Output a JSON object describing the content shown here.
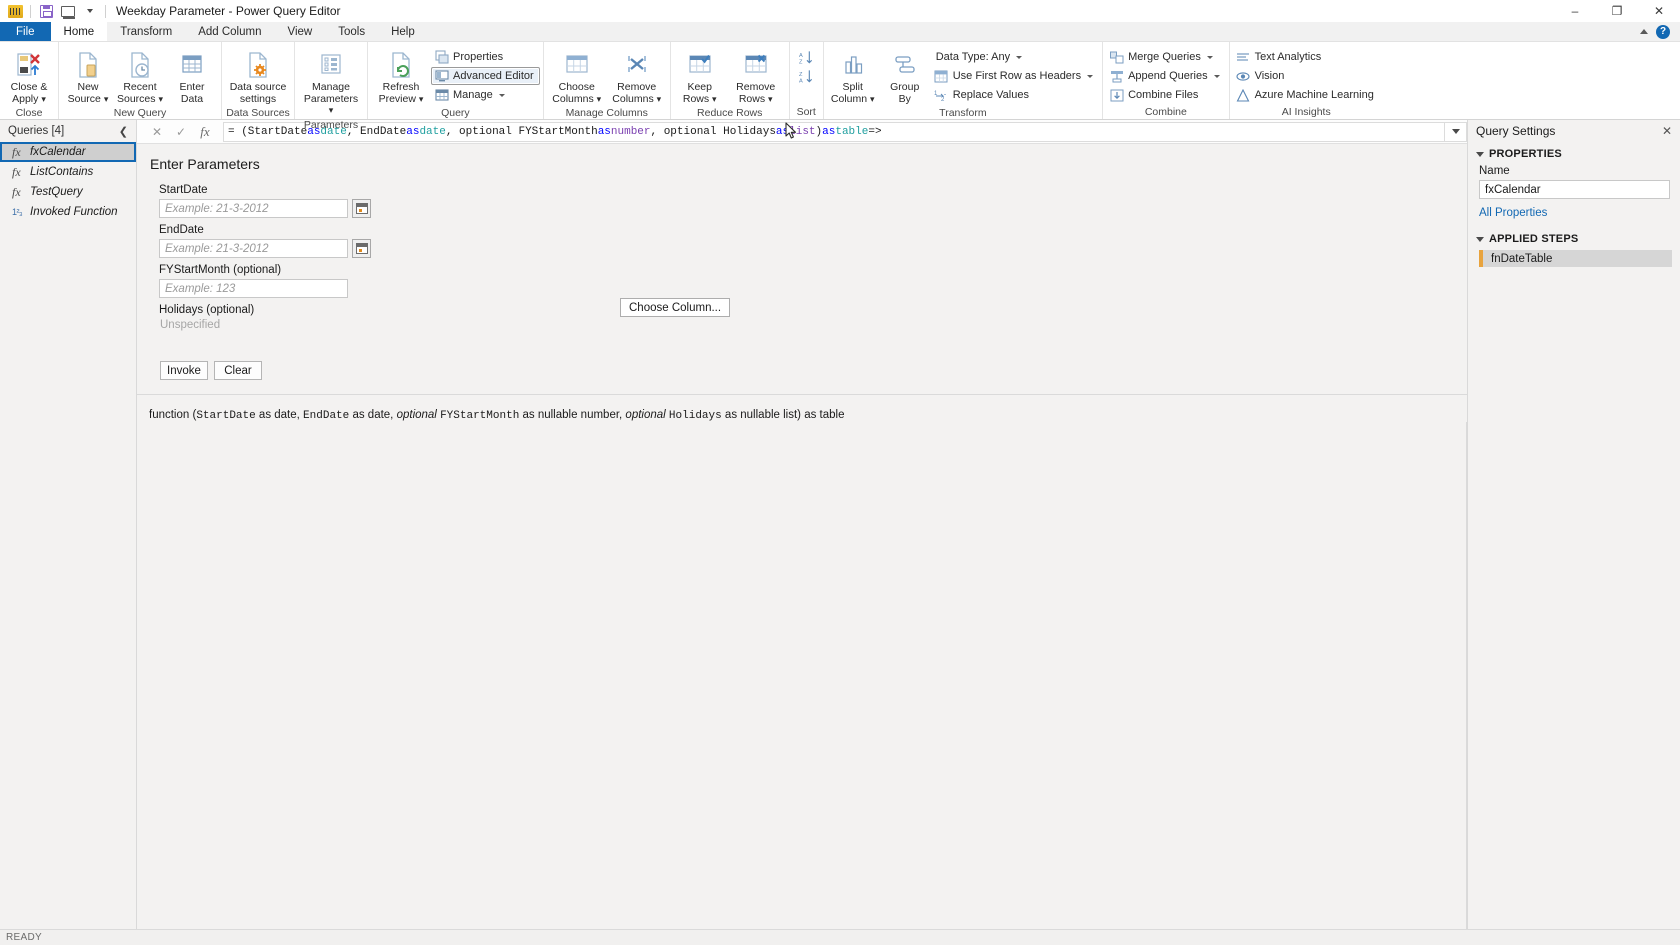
{
  "titlebar": {
    "app_icon": "power-bi-icon",
    "quick_access": [
      {
        "name": "save-icon",
        "label": "Save"
      },
      {
        "name": "undo-icon",
        "label": "Undo"
      },
      {
        "name": "customize-caret-icon",
        "label": "Customize Quick Access Toolbar"
      }
    ],
    "title": "Weekday Parameter - Power Query Editor",
    "minimize": "–",
    "maximize": "❐",
    "close": "✕"
  },
  "tabs": [
    {
      "label": "File",
      "id": "file"
    },
    {
      "label": "Home",
      "id": "home"
    },
    {
      "label": "Transform",
      "id": "transform"
    },
    {
      "label": "Add Column",
      "id": "add-column"
    },
    {
      "label": "View",
      "id": "view"
    },
    {
      "label": "Tools",
      "id": "tools"
    },
    {
      "label": "Help",
      "id": "help"
    }
  ],
  "active_tab": "Home",
  "tabstrip_right": {
    "collapse_ribbon": "collapse-ribbon-icon",
    "help": "?"
  },
  "ribbon": {
    "groups": [
      {
        "label": "Close",
        "big_buttons": [
          {
            "name": "close-and-apply-button",
            "line1": "Close &",
            "line2": "Apply",
            "dropdown": true
          }
        ],
        "small_buttons": []
      },
      {
        "label": "New Query",
        "big_buttons": [
          {
            "name": "new-source-button",
            "line1": "New",
            "line2": "Source",
            "dropdown": true
          },
          {
            "name": "recent-sources-button",
            "line1": "Recent",
            "line2": "Sources",
            "dropdown": true
          },
          {
            "name": "enter-data-button",
            "line1": "Enter",
            "line2": "Data",
            "dropdown": false
          }
        ],
        "small_buttons": []
      },
      {
        "label": "Data Sources",
        "big_buttons": [
          {
            "name": "data-source-settings-button",
            "line1": "Data source",
            "line2": "settings",
            "dropdown": false
          }
        ],
        "small_buttons": []
      },
      {
        "label": "Parameters",
        "big_buttons": [
          {
            "name": "manage-parameters-button",
            "line1": "Manage",
            "line2": "Parameters",
            "dropdown": true
          }
        ],
        "small_buttons": []
      },
      {
        "label": "Query",
        "big_buttons": [
          {
            "name": "refresh-preview-button",
            "line1": "Refresh",
            "line2": "Preview",
            "dropdown": true
          }
        ],
        "small_buttons": [
          {
            "name": "properties-button",
            "label": "Properties",
            "icon": "properties-icon",
            "dropdown": false,
            "hovered": false
          },
          {
            "name": "advanced-editor-button",
            "label": "Advanced Editor",
            "icon": "advanced-editor-icon",
            "dropdown": false,
            "hovered": true
          },
          {
            "name": "manage-button",
            "label": "Manage",
            "icon": "manage-icon",
            "dropdown": true,
            "hovered": false
          }
        ]
      },
      {
        "label": "Manage Columns",
        "big_buttons": [
          {
            "name": "choose-columns-button",
            "line1": "Choose",
            "line2": "Columns",
            "dropdown": true
          },
          {
            "name": "remove-columns-button",
            "line1": "Remove",
            "line2": "Columns",
            "dropdown": true
          }
        ],
        "small_buttons": []
      },
      {
        "label": "Reduce Rows",
        "big_buttons": [
          {
            "name": "keep-rows-button",
            "line1": "Keep",
            "line2": "Rows",
            "dropdown": true
          },
          {
            "name": "remove-rows-button",
            "line1": "Remove",
            "line2": "Rows",
            "dropdown": true
          }
        ],
        "small_buttons": []
      },
      {
        "label": "Sort",
        "big_buttons": [],
        "sort_buttons": [
          {
            "name": "sort-ascending-button",
            "label": "A↓"
          },
          {
            "name": "sort-descending-button",
            "label": "Z↓"
          }
        ],
        "small_buttons": []
      },
      {
        "label": "Transform",
        "big_buttons": [
          {
            "name": "split-column-button",
            "line1": "Split",
            "line2": "Column",
            "dropdown": true
          },
          {
            "name": "group-by-button",
            "line1": "Group",
            "line2": "By",
            "dropdown": false
          }
        ],
        "small_buttons": [
          {
            "name": "data-type-button",
            "label": "Data Type: Any",
            "icon": "data-type-icon",
            "dropdown": true,
            "hovered": false
          },
          {
            "name": "use-first-row-as-headers-button",
            "label": "Use First Row as Headers",
            "icon": "headers-icon",
            "dropdown": true,
            "hovered": false
          },
          {
            "name": "replace-values-button",
            "label": "Replace Values",
            "icon": "replace-values-icon",
            "dropdown": false,
            "hovered": false
          }
        ]
      },
      {
        "label": "Combine",
        "big_buttons": [],
        "small_buttons": [
          {
            "name": "merge-queries-button",
            "label": "Merge Queries",
            "icon": "merge-queries-icon",
            "dropdown": true,
            "hovered": false
          },
          {
            "name": "append-queries-button",
            "label": "Append Queries",
            "icon": "append-queries-icon",
            "dropdown": true,
            "hovered": false
          },
          {
            "name": "combine-files-button",
            "label": "Combine Files",
            "icon": "combine-files-icon",
            "dropdown": false,
            "hovered": false
          }
        ]
      },
      {
        "label": "AI Insights",
        "big_buttons": [],
        "small_buttons": [
          {
            "name": "text-analytics-button",
            "label": "Text Analytics",
            "icon": "text-analytics-icon",
            "dropdown": false,
            "hovered": false
          },
          {
            "name": "vision-button",
            "label": "Vision",
            "icon": "vision-icon",
            "dropdown": false,
            "hovered": false
          },
          {
            "name": "azure-machine-learning-button",
            "label": "Azure Machine Learning",
            "icon": "azure-ml-icon",
            "dropdown": false,
            "hovered": false
          }
        ]
      }
    ]
  },
  "queries_pane": {
    "header": "Queries [4]",
    "collapse_icon": "chevron-left-icon",
    "items": [
      {
        "label": "fxCalendar",
        "icon": "function-icon",
        "selected": true
      },
      {
        "label": "ListContains",
        "icon": "function-icon",
        "selected": false
      },
      {
        "label": "TestQuery",
        "icon": "function-icon",
        "selected": false
      },
      {
        "label": "Invoked Function",
        "icon": "number-icon",
        "selected": false
      }
    ]
  },
  "formula_bar": {
    "cancel_icon": "✕",
    "commit_icon": "✓",
    "fx_icon": "fx",
    "formula_segments": [
      {
        "t": "= (StartDate ",
        "c": "plain"
      },
      {
        "t": "as",
        "c": "kw"
      },
      {
        "t": " ",
        "c": "plain"
      },
      {
        "t": "date",
        "c": "typ"
      },
      {
        "t": ", EndDate ",
        "c": "plain"
      },
      {
        "t": "as",
        "c": "kw"
      },
      {
        "t": " ",
        "c": "plain"
      },
      {
        "t": "date",
        "c": "typ"
      },
      {
        "t": ", optional FYStartMonth ",
        "c": "plain"
      },
      {
        "t": "as",
        "c": "kw"
      },
      {
        "t": " ",
        "c": "plain"
      },
      {
        "t": "number",
        "c": "typ2"
      },
      {
        "t": ", optional Holidays ",
        "c": "plain"
      },
      {
        "t": "as",
        "c": "kw"
      },
      {
        "t": " ",
        "c": "plain"
      },
      {
        "t": "list",
        "c": "typ2"
      },
      {
        "t": ") ",
        "c": "plain"
      },
      {
        "t": "as",
        "c": "kw"
      },
      {
        "t": " ",
        "c": "plain"
      },
      {
        "t": "table",
        "c": "typ"
      },
      {
        "t": " =>",
        "c": "plain"
      }
    ],
    "expand_icon": "chevron-down-icon"
  },
  "invoke_panel": {
    "title": "Enter Parameters",
    "fields": [
      {
        "name": "startdate",
        "label": "StartDate",
        "value": "",
        "placeholder": "Example: 21-3-2012",
        "has_date_picker": true
      },
      {
        "name": "enddate",
        "label": "EndDate",
        "value": "",
        "placeholder": "Example: 21-3-2012",
        "has_date_picker": true
      },
      {
        "name": "fystartmonth",
        "label": "FYStartMonth (optional)",
        "value": "",
        "placeholder": "Example: 123",
        "has_date_picker": false
      }
    ],
    "holidays": {
      "label": "Holidays (optional)",
      "value": "Unspecified",
      "choose_column_label": "Choose Column..."
    },
    "invoke_label": "Invoke",
    "clear_label": "Clear",
    "signature": [
      {
        "t": "function (",
        "c": "plain"
      },
      {
        "t": "StartDate",
        "c": "mono"
      },
      {
        "t": " as date, ",
        "c": "plain"
      },
      {
        "t": "EndDate",
        "c": "mono"
      },
      {
        "t": " as date, ",
        "c": "plain"
      },
      {
        "t": "optional",
        "c": "italic"
      },
      {
        "t": " ",
        "c": "plain"
      },
      {
        "t": "FYStartMonth",
        "c": "mono"
      },
      {
        "t": " as nullable number, ",
        "c": "plain"
      },
      {
        "t": "optional",
        "c": "italic"
      },
      {
        "t": " ",
        "c": "plain"
      },
      {
        "t": "Holidays",
        "c": "mono"
      },
      {
        "t": " as nullable list) as table",
        "c": "plain"
      }
    ]
  },
  "query_settings": {
    "header": "Query Settings",
    "close_icon": "✕",
    "properties_section": "PROPERTIES",
    "name_label": "Name",
    "name_value": "fxCalendar",
    "all_properties_link": "All Properties",
    "applied_steps_section": "APPLIED STEPS",
    "steps": [
      {
        "label": "fnDateTable",
        "selected": true
      }
    ]
  },
  "statusbar": {
    "status": "READY"
  },
  "colors": {
    "file_tab_blue": "#1268b3",
    "selection_blue": "#1268b3",
    "step_accent": "#e8a33d",
    "link_blue": "#1268b3",
    "panel_gray": "#f3f2f1"
  }
}
